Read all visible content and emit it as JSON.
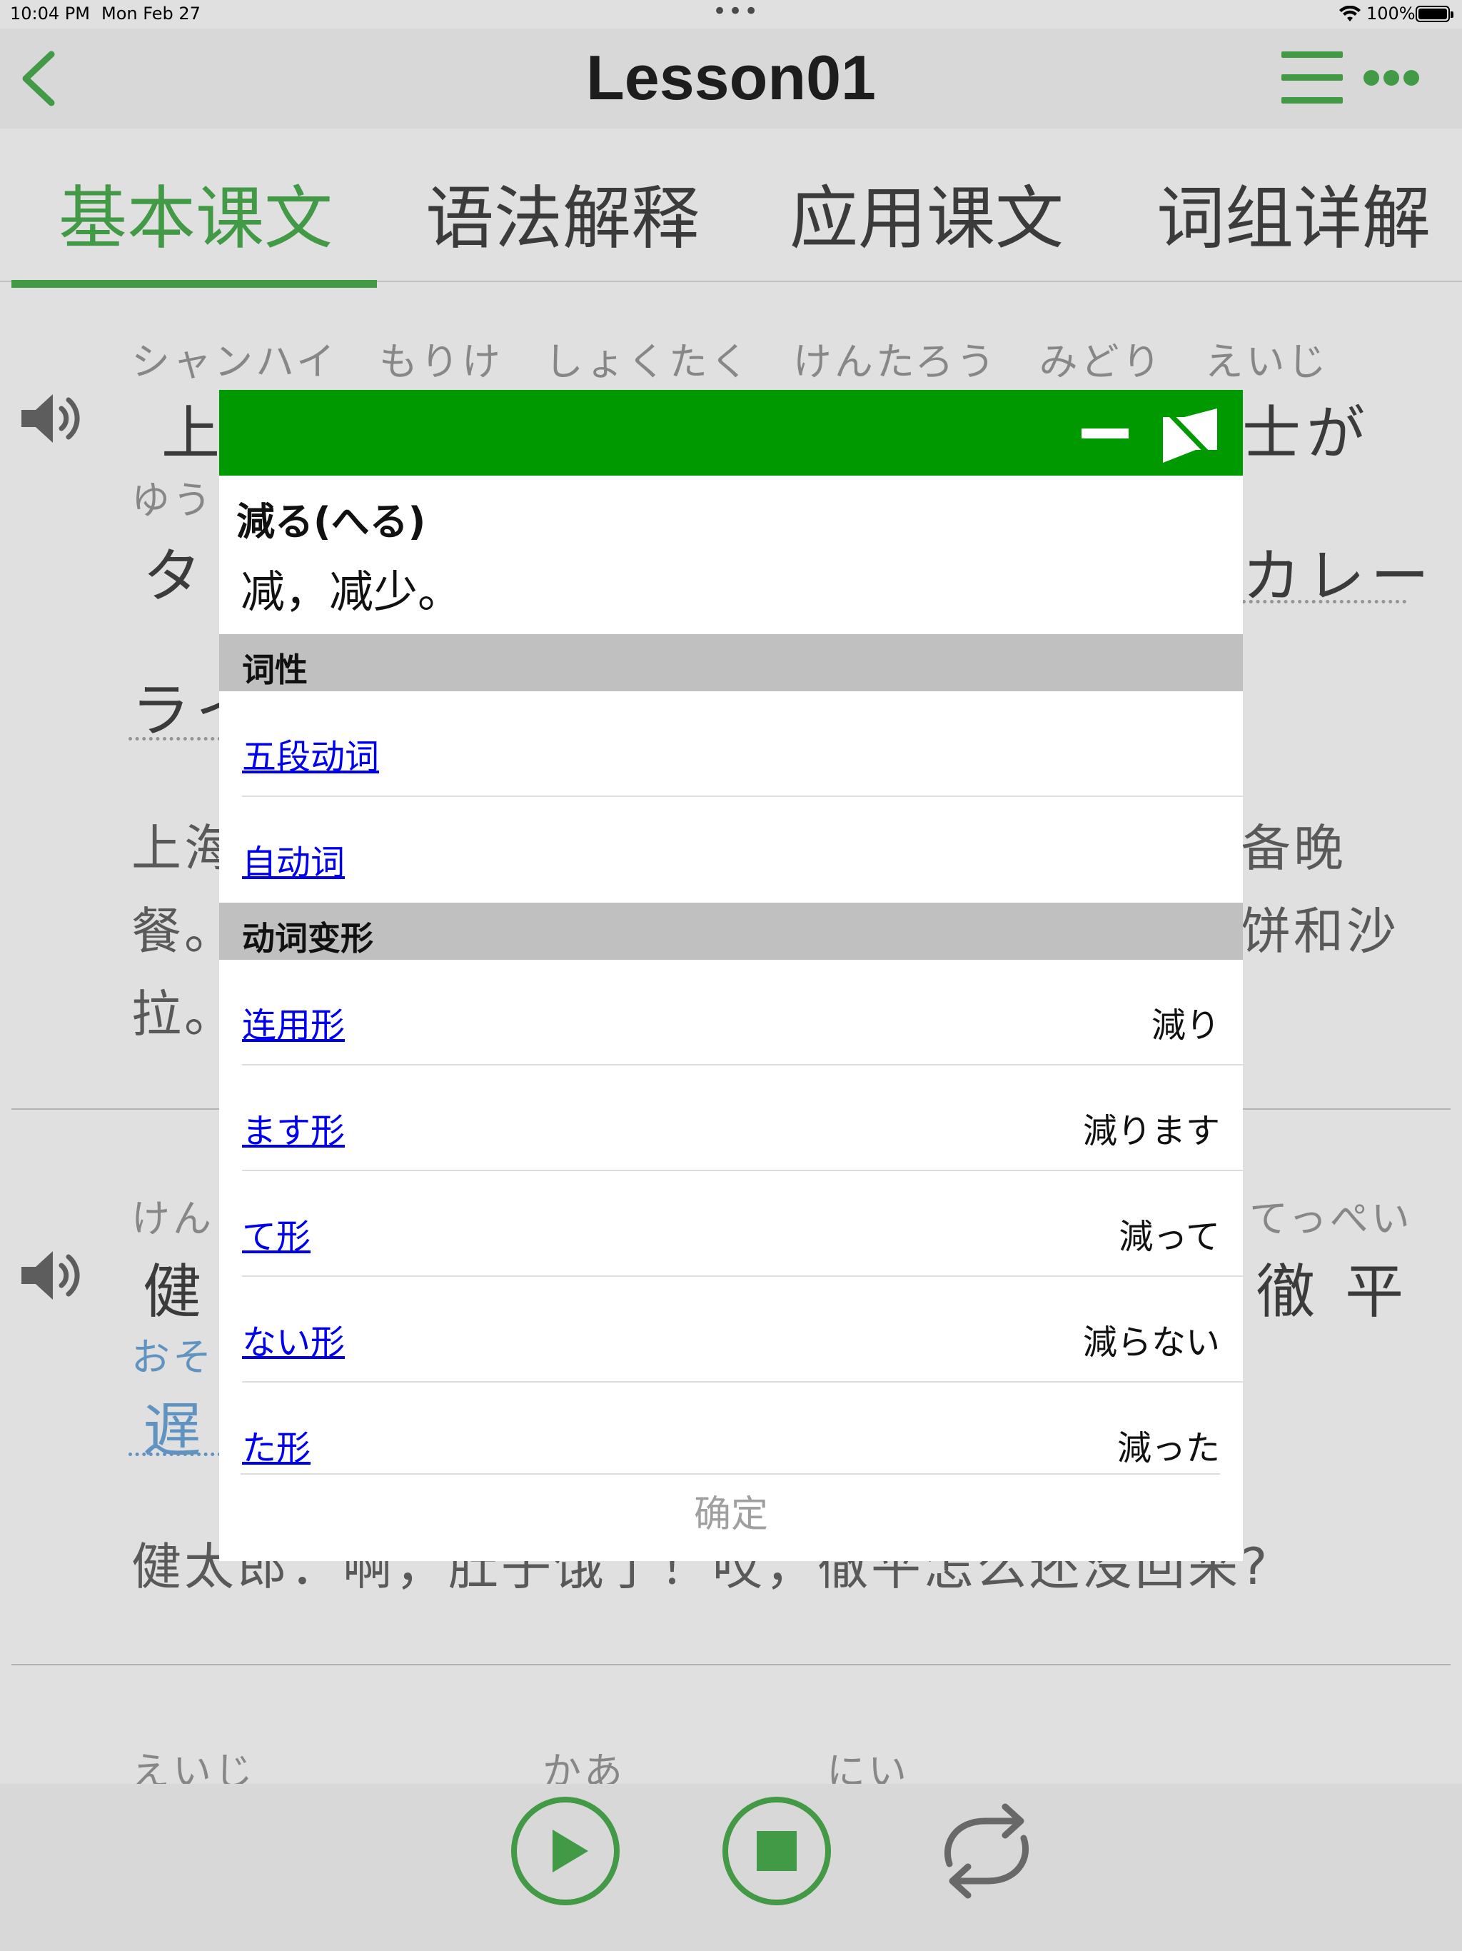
{
  "status_bar": {
    "time": "10:04 PM",
    "date": "Mon Feb 27",
    "battery": "100%"
  },
  "nav": {
    "title": "Lesson01",
    "accent_color": "#4caf50"
  },
  "tabs": [
    {
      "label": "基本课文",
      "active": true
    },
    {
      "label": "语法解释",
      "active": false
    },
    {
      "label": "应用课文",
      "active": false
    },
    {
      "label": "词组详解",
      "active": false
    }
  ],
  "content": {
    "block1": {
      "ruby_line1": "シャンハイ　もりけ　しょくたく　けんたろう　みどり　えいじ",
      "jp_line1_left": "上",
      "jp_line1_right": "士が",
      "ruby_line2": "ゆう",
      "jp_line2_left": "タ",
      "jp_line2_right": "カレー",
      "jp_line3_left": "ライ",
      "cn_line1_left": "上海",
      "cn_line1_right": "备晚",
      "cn_line2_left": "餐。",
      "cn_line2_right": "饼和沙",
      "cn_line3_left": "拉。"
    },
    "block2": {
      "ruby_left": "けん",
      "ruby_right": "てっぺい",
      "jp_left": "健",
      "jp_right": "徹 平",
      "ruby_blue": "おそ",
      "jp_blue": "遅",
      "cn_line": "健太郎：啊，肚子饿了！哎，徹平怎么还没回来?"
    },
    "block3": {
      "ruby_1": "えいじ",
      "ruby_2": "かあ",
      "ruby_3": "にい"
    }
  },
  "dialog": {
    "word": "減る(へる)",
    "meaning": "减，减少。",
    "pos_header": "词性",
    "pos_items": [
      "五段动词",
      "自动词"
    ],
    "conj_header": "动词变形",
    "conjugations": [
      {
        "form": "连用形",
        "value": "減り"
      },
      {
        "form": "ます形",
        "value": "減ります"
      },
      {
        "form": "て形",
        "value": "減って"
      },
      {
        "form": "ない形",
        "value": "減らない"
      },
      {
        "form": "た形",
        "value": "減った"
      }
    ],
    "confirm_label": "确定",
    "header_color": "#009900"
  }
}
